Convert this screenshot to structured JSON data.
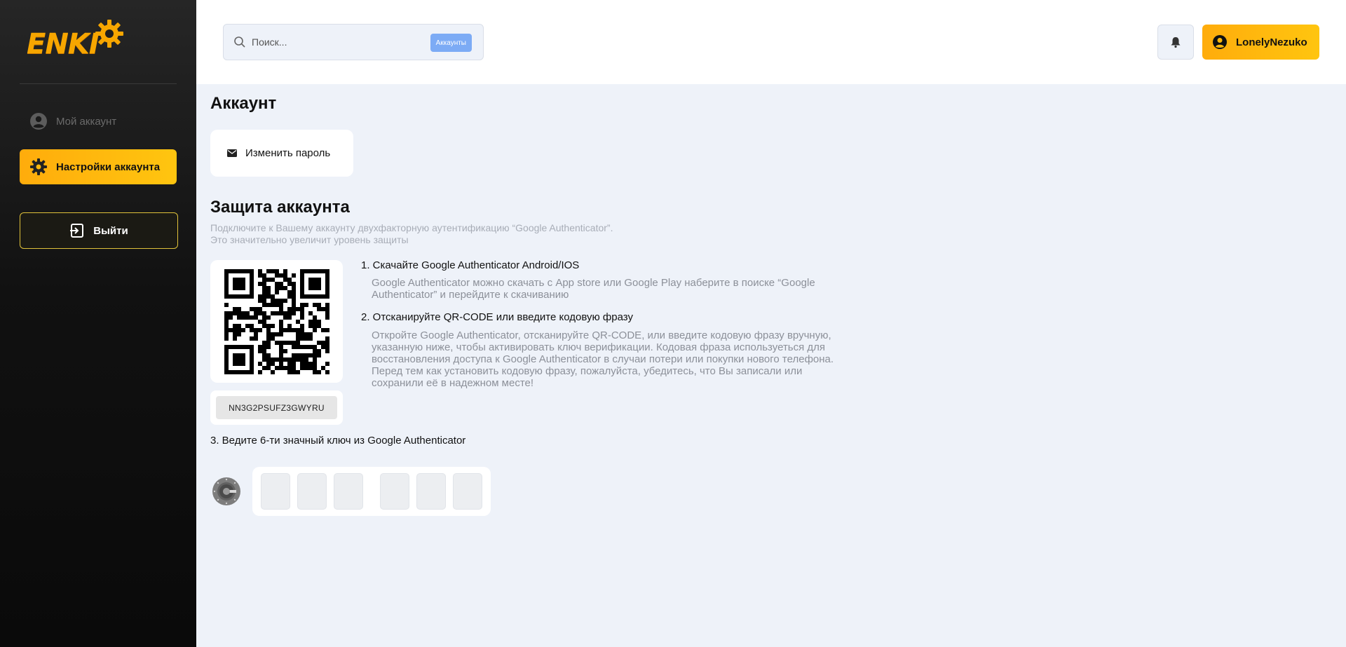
{
  "brand": {
    "logo_text": "ENKI",
    "accent": "#ffb80c"
  },
  "sidebar": {
    "items": [
      {
        "label": "Мой аккаунт",
        "icon": "user-circle-icon"
      },
      {
        "label": "Настройки аккаунта",
        "icon": "gear-icon"
      }
    ],
    "logout_label": "Выйти"
  },
  "header": {
    "search": {
      "placeholder": "Поиск...",
      "chip": "Аккаунты"
    },
    "bell_icon": "bell-icon",
    "user": {
      "name": "LonelyNezuko",
      "icon": "user-circle-icon"
    }
  },
  "main": {
    "title": "Аккаунт",
    "change_password_label": "Изменить пароль",
    "security": {
      "title": "Защита аккаунта",
      "subtitle_line1": "Подключите к Вашему аккаунту двухфакторную аутентификацию “Google Authenticator”.",
      "subtitle_line2": "Это значительно увеличит уровень защиты",
      "code": "NN3G2PSUFZ3GWYRU",
      "steps": [
        {
          "title": "1. Скачайте Google Authenticator Android/IOS",
          "text": "Google Authenticator можно скачать с App store или Google Play наберите в поиске “Google Authenticator” и перейдите к скачиванию"
        },
        {
          "title": "2. Отсканируйте QR-CODE или введите кодовую фразу",
          "text": "Откройте Google Authenticator, отсканируйте QR-CODE, или введите кодовую фразу вручную, указанную ниже, чтобы активировать ключ верификации. Кодовая фраза используеться для восстановления доступа к Google Authenticator в случаи потери или покупки нового телефона. Перед тем как установить кодовую фразу, пожалуйста, убедитесь, что Вы записали или сохранили её в надежном месте!"
        },
        {
          "title": "3. Ведите 6-ти значный ключ из Google Authenticator"
        }
      ],
      "otp_length": 6
    }
  }
}
